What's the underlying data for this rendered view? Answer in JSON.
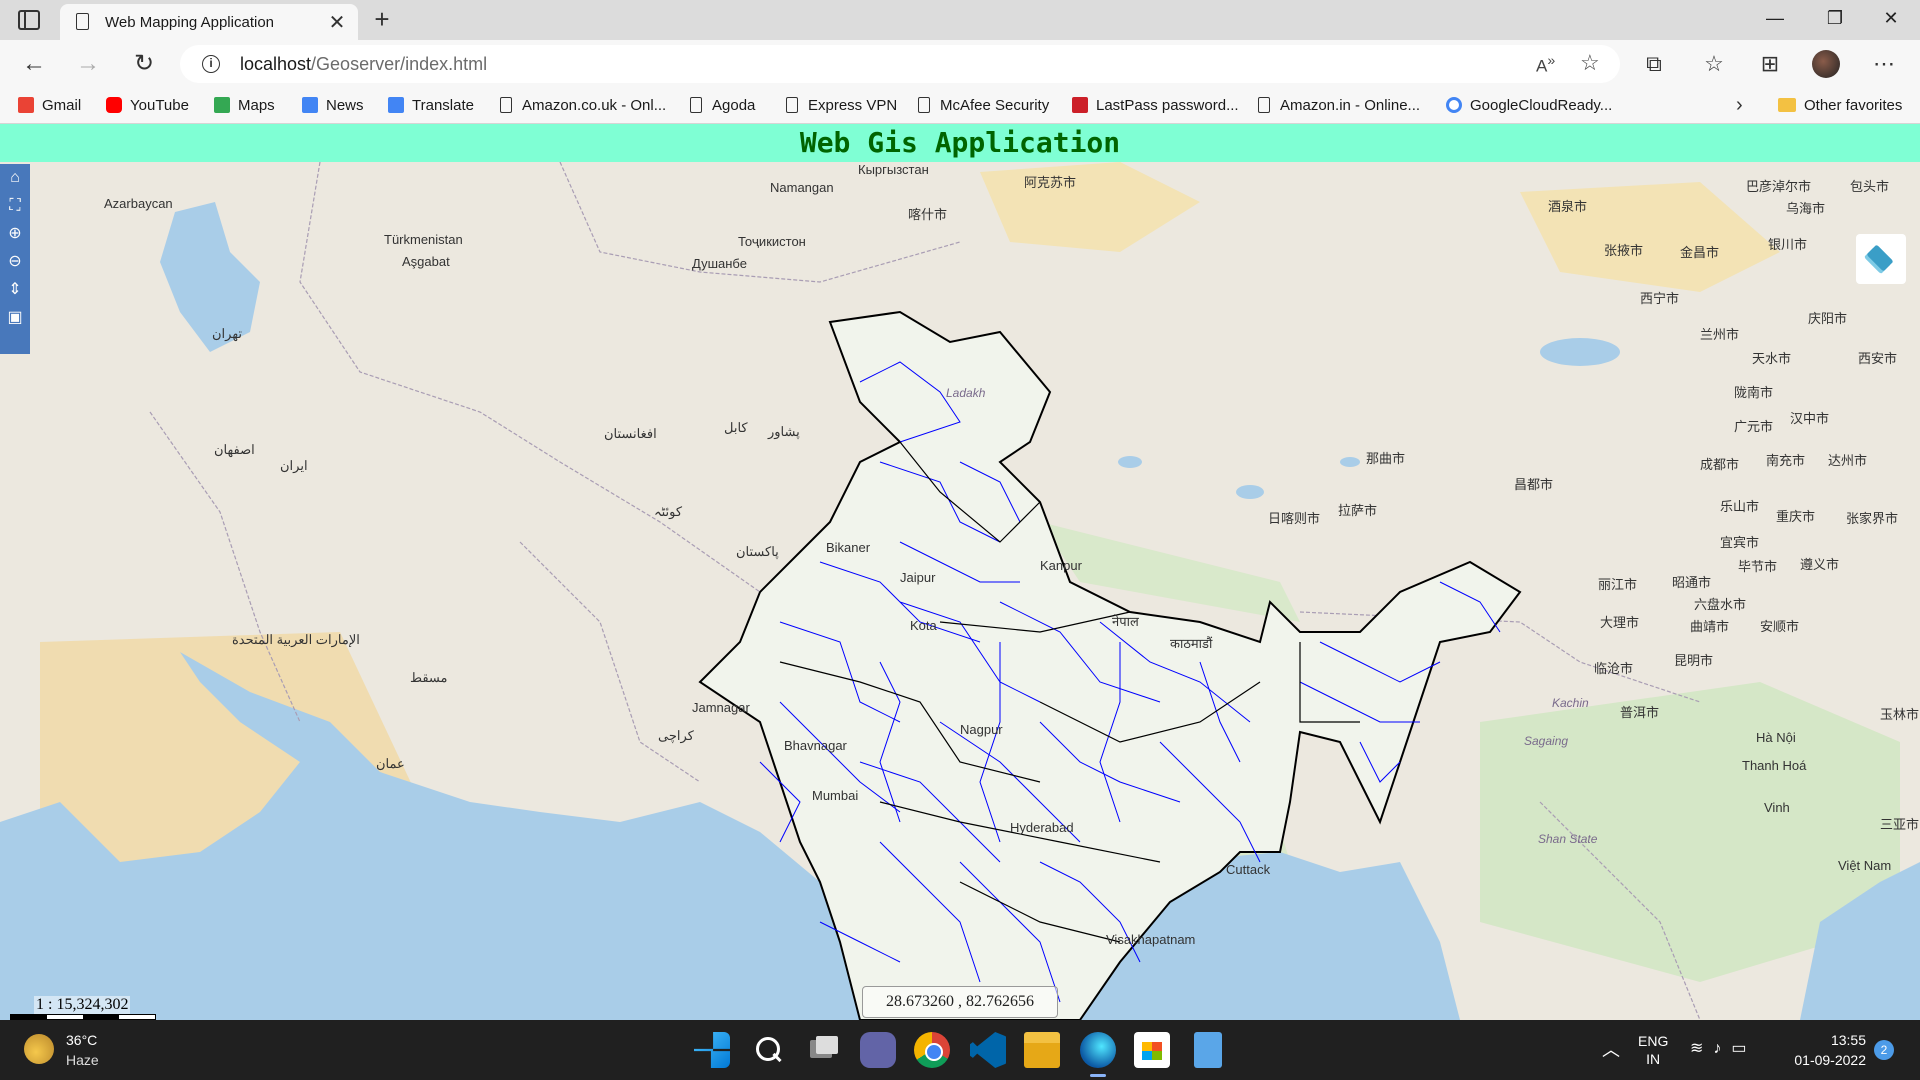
{
  "browser": {
    "tab_title": "Web Mapping Application",
    "url_host": "localhost",
    "url_path": "/Geoserver/index.html",
    "bookmarks": [
      {
        "label": "Gmail",
        "icon": "gmail-icon",
        "color": "#ea4335"
      },
      {
        "label": "YouTube",
        "icon": "youtube-icon",
        "color": "#ff0000"
      },
      {
        "label": "Maps",
        "icon": "maps-icon",
        "color": "#34a853"
      },
      {
        "label": "News",
        "icon": "news-icon",
        "color": "#4285f4"
      },
      {
        "label": "Translate",
        "icon": "translate-icon",
        "color": "#4285f4"
      },
      {
        "label": "Amazon.co.uk - Onl...",
        "icon": "page-icon"
      },
      {
        "label": "Agoda",
        "icon": "page-icon"
      },
      {
        "label": "Express VPN",
        "icon": "page-icon"
      },
      {
        "label": "McAfee Security",
        "icon": "page-icon"
      },
      {
        "label": "LastPass password...",
        "icon": "lastpass-icon",
        "color": "#cc2029"
      },
      {
        "label": "Amazon.in - Online...",
        "icon": "page-icon"
      },
      {
        "label": "GoogleCloudReady...",
        "icon": "google-icon",
        "color": "#4285f4"
      }
    ],
    "other_favorites": "Other favorites"
  },
  "page": {
    "title": "Web Gis Application",
    "header_bg": "#7fffd4",
    "title_color": "#006400"
  },
  "map": {
    "scale": "1 : 15,324,302",
    "coordinates": "28.673260 , 82.762656",
    "boundary_color": "#0000ff",
    "labels": [
      "Azarbaycan",
      "Türkmenistan",
      "Aşgabat",
      "Namangan",
      "Кыргызстан",
      "Тоҷикистон",
      "Душанбе",
      "阿克苏市",
      "喀什市",
      "酒泉市",
      "张掖市",
      "金昌市",
      "银川市",
      "乌海市",
      "包头市",
      "巴彦淖尔市",
      "西宁市",
      "兰州市",
      "天水市",
      "庆阳市",
      "西安市",
      "陇南市",
      "汉中市",
      "广元市",
      "南充市",
      "达州市",
      "成都市",
      "乐山市",
      "重庆市",
      "张家界市",
      "宜宾市",
      "毕节市",
      "遵义市",
      "丽江市",
      "昭通市",
      "六盘水市",
      "曲靖市",
      "安顺市",
      "大理市",
      "昆明市",
      "临沧市",
      "普洱市",
      "玉林市",
      "Hà Nội",
      "Thanh Hoá",
      "Vinh",
      "三亚市",
      "Việt Nam",
      "那曲市",
      "昌都市",
      "拉萨市",
      "日喀则市",
      "Ladakh",
      "Bikaner",
      "Jaipur",
      "Kota",
      "Nagpur",
      "Mumbai",
      "Jamnagar",
      "Bhavnagar",
      "Hyderabad",
      "Visakhapatnam",
      "Cuttack",
      "Kanpur",
      "नेपाल",
      "काठमाडौं",
      "Kachin",
      "Sagaing",
      "Shan State",
      "كابل",
      "پشاور",
      "كوئٹہ",
      "پاکستان",
      "كراچی",
      "افغانستان",
      "ایران",
      "اصفهان",
      "تهران",
      "مسقط",
      "عمان",
      "الإمارات العربية المتحدة"
    ]
  },
  "taskbar": {
    "temperature": "36°C",
    "weather": "Haze",
    "lang_top": "ENG",
    "lang_bottom": "IN",
    "time": "13:55",
    "date": "01-09-2022",
    "notifications": "2"
  }
}
